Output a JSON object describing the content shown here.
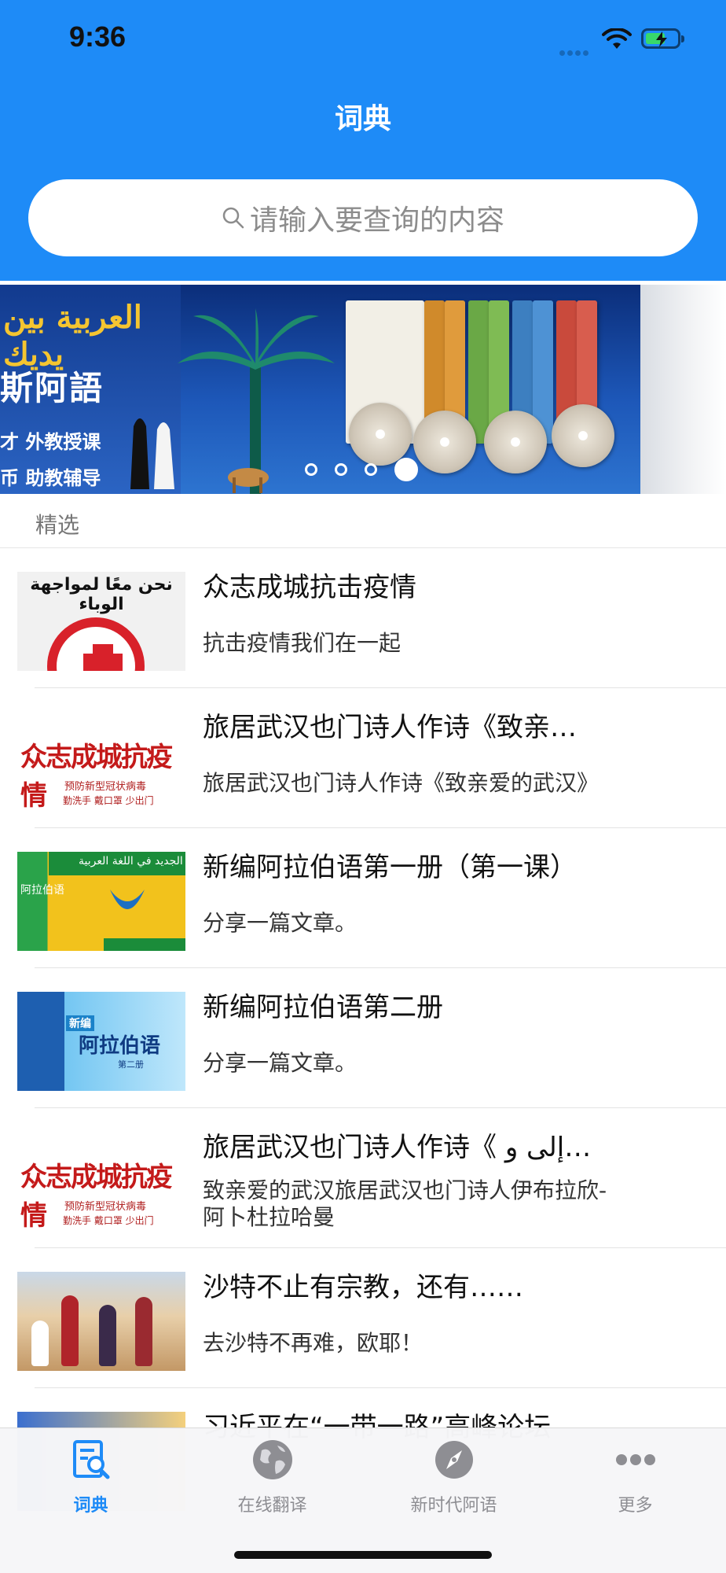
{
  "status_bar": {
    "time": "9:36"
  },
  "header": {
    "title": "词典",
    "search": {
      "placeholder": "请输入要查询的内容"
    }
  },
  "banner": {
    "arabic_title": "العربية بين يديك",
    "title": "斯阿語",
    "line1": "才 外教授课",
    "line2": "币 助教辅导",
    "slide_count": 4,
    "active_slide": 4
  },
  "featured": {
    "label": "精选",
    "items": [
      {
        "title": "众志成城抗击疫情",
        "desc": "抗击疫情我们在一起",
        "thumb_icon": "anti-epidemic-emblem-thumbnail",
        "thumb_text": "نحن معًا لمواجهة الوباء"
      },
      {
        "title": "旅居武汉也门诗人作诗《致亲…",
        "desc": "旅居武汉也门诗人作诗《致亲爱的武汉》",
        "thumb_icon": "calligraphy-thumbnail",
        "thumb_text": "众志成城抗疫情",
        "thumb_sub1": "预防新型冠状病毒",
        "thumb_sub2": "勤洗手 戴口罩 少出门"
      },
      {
        "title": "新编阿拉伯语第一册（第一课）",
        "desc": "分享一篇文章。",
        "thumb_icon": "textbook-cover-thumbnail",
        "thumb_text": "الجديد في اللغة العربية",
        "thumb_sub1": "阿拉伯语"
      },
      {
        "title": "新编阿拉伯语第二册",
        "desc": "分享一篇文章。",
        "thumb_icon": "textbook-cover-thumbnail",
        "thumb_text": "新编",
        "thumb_sub1": "阿拉伯语",
        "thumb_sub2": "第二册"
      },
      {
        "title": "旅居武汉也门诗人作诗《 إلى و…",
        "desc": "致亲爱的武汉旅居武汉也门诗人伊布拉欣-阿卜杜拉哈曼",
        "thumb_icon": "calligraphy-thumbnail",
        "thumb_text": "众志成城抗疫情",
        "thumb_sub1": "预防新型冠状病毒",
        "thumb_sub2": "勤洗手 戴口罩 少出门"
      },
      {
        "title": "沙特不止有宗教，还有……",
        "desc": "去沙特不再难，欧耶！",
        "thumb_icon": "saudi-dancers-photo-thumbnail"
      },
      {
        "title": "习近平在“一带一路”高峰论坛",
        "desc": "",
        "thumb_icon": "belt-and-road-thumbnail"
      }
    ]
  },
  "tabbar": {
    "tabs": [
      {
        "label": "词典",
        "icon": "dictionary-search-icon",
        "active": true
      },
      {
        "label": "在线翻译",
        "icon": "globe-icon",
        "active": false
      },
      {
        "label": "新时代阿语",
        "icon": "compass-icon",
        "active": false
      },
      {
        "label": "更多",
        "icon": "more-dots-icon",
        "active": false
      }
    ]
  },
  "colors": {
    "primary": "#1e8bf7",
    "tab_inactive": "#8e8e93",
    "banner_dark": "#0b2e7a",
    "emblem_red": "#d8212a"
  }
}
